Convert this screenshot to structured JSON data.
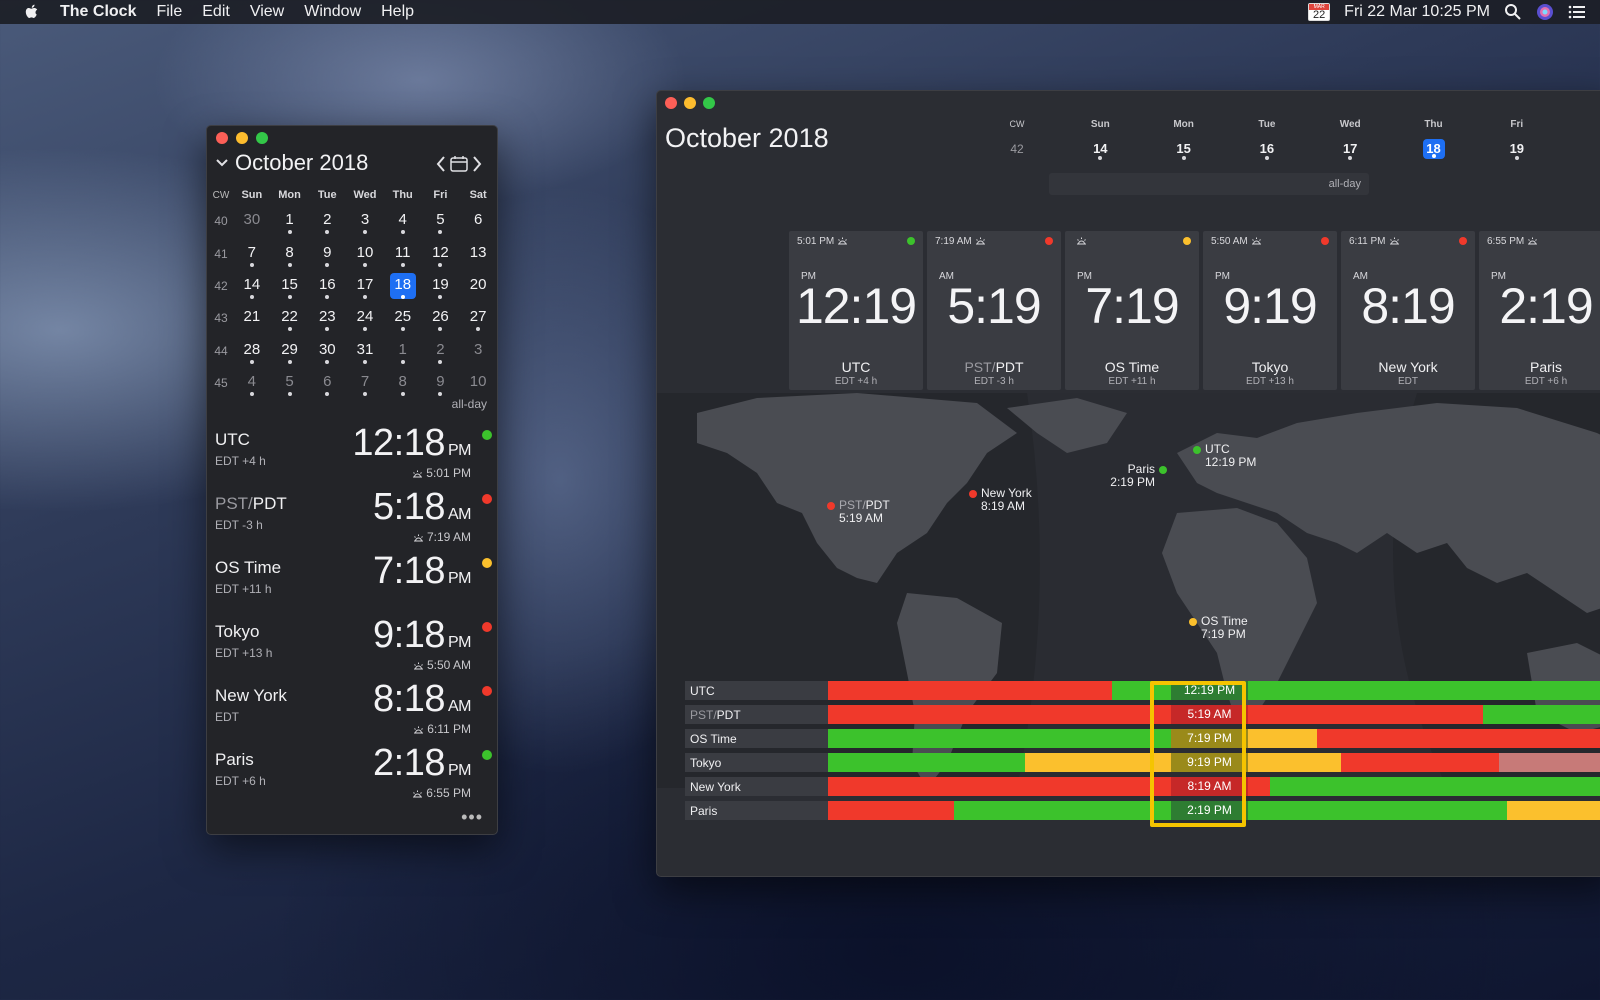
{
  "menubar": {
    "app_name": "The Clock",
    "menus": [
      "File",
      "Edit",
      "View",
      "Window",
      "Help"
    ],
    "cal_month": "MAR",
    "cal_day": "22",
    "datetime": "Fri 22 Mar  10:25 PM"
  },
  "colors": {
    "green": "#3cc22c",
    "red": "#f0392b",
    "yellow": "#fbc02d",
    "accent": "#1e6ff3",
    "highlight": "#f5c400"
  },
  "small": {
    "month_title": "October 2018",
    "headers": [
      "CW",
      "Sun",
      "Mon",
      "Tue",
      "Wed",
      "Thu",
      "Fri",
      "Sat"
    ],
    "weeks": [
      {
        "wk": "40",
        "days": [
          {
            "d": "30",
            "dim": true
          },
          {
            "d": "1",
            "dot": true
          },
          {
            "d": "2",
            "dot": true
          },
          {
            "d": "3",
            "dot": true
          },
          {
            "d": "4",
            "dot": true
          },
          {
            "d": "5",
            "dot": true
          },
          {
            "d": "6"
          }
        ]
      },
      {
        "wk": "41",
        "days": [
          {
            "d": "7",
            "dot": true
          },
          {
            "d": "8",
            "dot": true
          },
          {
            "d": "9",
            "dot": true
          },
          {
            "d": "10",
            "dot": true
          },
          {
            "d": "11",
            "dot": true
          },
          {
            "d": "12",
            "dot": true
          },
          {
            "d": "13"
          }
        ]
      },
      {
        "wk": "42",
        "days": [
          {
            "d": "14",
            "dot": true
          },
          {
            "d": "15",
            "dot": true
          },
          {
            "d": "16",
            "dot": true
          },
          {
            "d": "17",
            "dot": true
          },
          {
            "d": "18",
            "dot": true,
            "today": true
          },
          {
            "d": "19",
            "dot": true
          },
          {
            "d": "20"
          }
        ]
      },
      {
        "wk": "43",
        "days": [
          {
            "d": "21"
          },
          {
            "d": "22",
            "dot": true
          },
          {
            "d": "23",
            "dot": true
          },
          {
            "d": "24",
            "dot": true
          },
          {
            "d": "25",
            "dot": true
          },
          {
            "d": "26",
            "dot": true
          },
          {
            "d": "27",
            "dot": true
          }
        ]
      },
      {
        "wk": "44",
        "days": [
          {
            "d": "28",
            "dot": true
          },
          {
            "d": "29",
            "dot": true
          },
          {
            "d": "30",
            "dot": true
          },
          {
            "d": "31",
            "dot": true
          },
          {
            "d": "1",
            "dim": true,
            "dot": true
          },
          {
            "d": "2",
            "dim": true,
            "dot": true
          },
          {
            "d": "3",
            "dim": true
          }
        ]
      },
      {
        "wk": "45",
        "days": [
          {
            "d": "4",
            "dim": true,
            "dot": true
          },
          {
            "d": "5",
            "dim": true,
            "dot": true
          },
          {
            "d": "6",
            "dim": true,
            "dot": true
          },
          {
            "d": "7",
            "dim": true,
            "dot": true
          },
          {
            "d": "8",
            "dim": true,
            "dot": true
          },
          {
            "d": "9",
            "dim": true,
            "dot": true
          },
          {
            "d": "10",
            "dim": true
          }
        ]
      }
    ],
    "all_day": "all-day",
    "zones": [
      {
        "name": "UTC",
        "offset": "EDT +4 h",
        "time": "12:18",
        "ampm": "PM",
        "sun": "5:01 PM",
        "status": "green"
      },
      {
        "name_dim": "PST/",
        "name": "PDT",
        "offset": "EDT -3 h",
        "time": "5:18",
        "ampm": "AM",
        "sun": "7:19 AM",
        "status": "red"
      },
      {
        "name": "OS Time",
        "offset": "EDT +11 h",
        "time": "7:18",
        "ampm": "PM",
        "sun": "",
        "status": "yellow"
      },
      {
        "name": "Tokyo",
        "offset": "EDT +13 h",
        "time": "9:18",
        "ampm": "PM",
        "sun": "5:50 AM",
        "status": "red"
      },
      {
        "name": "New York",
        "offset": "EDT",
        "time": "8:18",
        "ampm": "AM",
        "sun": "6:11 PM",
        "status": "red"
      },
      {
        "name": "Paris",
        "offset": "EDT +6 h",
        "time": "2:18",
        "ampm": "PM",
        "sun": "6:55 PM",
        "status": "green"
      }
    ],
    "more": "•••"
  },
  "big": {
    "month_title": "October 2018",
    "week": [
      {
        "l": "CW",
        "n": "42",
        "cw": true
      },
      {
        "l": "Sun",
        "n": "14"
      },
      {
        "l": "Mon",
        "n": "15"
      },
      {
        "l": "Tue",
        "n": "16"
      },
      {
        "l": "Wed",
        "n": "17"
      },
      {
        "l": "Thu",
        "n": "18",
        "today": true
      },
      {
        "l": "Fri",
        "n": "19"
      }
    ],
    "all_day": "all-day",
    "clocks": [
      {
        "sun": "5:01 PM",
        "status": "green",
        "ampm": "PM",
        "time": "12:19",
        "name": "UTC",
        "offset": "EDT +4 h"
      },
      {
        "sun": "7:19 AM",
        "status": "red",
        "ampm": "AM",
        "time": "5:19",
        "name_dim": "PST/",
        "name": "PDT",
        "offset": "EDT -3 h"
      },
      {
        "sun": "",
        "status": "yellow",
        "ampm": "PM",
        "time": "7:19",
        "name": "OS Time",
        "offset": "EDT +11 h"
      },
      {
        "sun": "5:50 AM",
        "status": "red",
        "ampm": "PM",
        "time": "9:19",
        "name": "Tokyo",
        "offset": "EDT +13 h"
      },
      {
        "sun": "6:11 PM",
        "status": "red",
        "ampm": "AM",
        "time": "8:19",
        "name": "New York",
        "offset": "EDT"
      },
      {
        "sun": "6:55 PM",
        "status": "",
        "ampm": "PM",
        "time": "2:19",
        "name": "Paris",
        "offset": "EDT +6 h"
      }
    ],
    "pins": [
      {
        "name": "UTC",
        "time": "12:19 PM",
        "status": "green"
      },
      {
        "name": "Paris",
        "time": "2:19 PM",
        "status": "green"
      },
      {
        "name_dim": "PST/",
        "name": "PDT",
        "time": "5:19 AM",
        "status": "red"
      },
      {
        "name": "New York",
        "time": "8:19 AM",
        "status": "red"
      },
      {
        "name": "OS Time",
        "time": "7:19 PM",
        "status": "yellow"
      }
    ],
    "timeline": [
      {
        "label": "UTC",
        "current": "12:19 PM",
        "current_status": "green"
      },
      {
        "label_dim": "PST/",
        "label": "PDT",
        "current": "5:19 AM",
        "current_status": "red"
      },
      {
        "label": "OS Time",
        "current": "7:19 PM",
        "current_status": "yellow"
      },
      {
        "label": "Tokyo",
        "current": "9:19 PM",
        "current_status": "yellow"
      },
      {
        "label": "New York",
        "current": "8:19 AM",
        "current_status": "red"
      },
      {
        "label": "Paris",
        "current": "2:19 PM",
        "current_status": "green"
      }
    ]
  }
}
